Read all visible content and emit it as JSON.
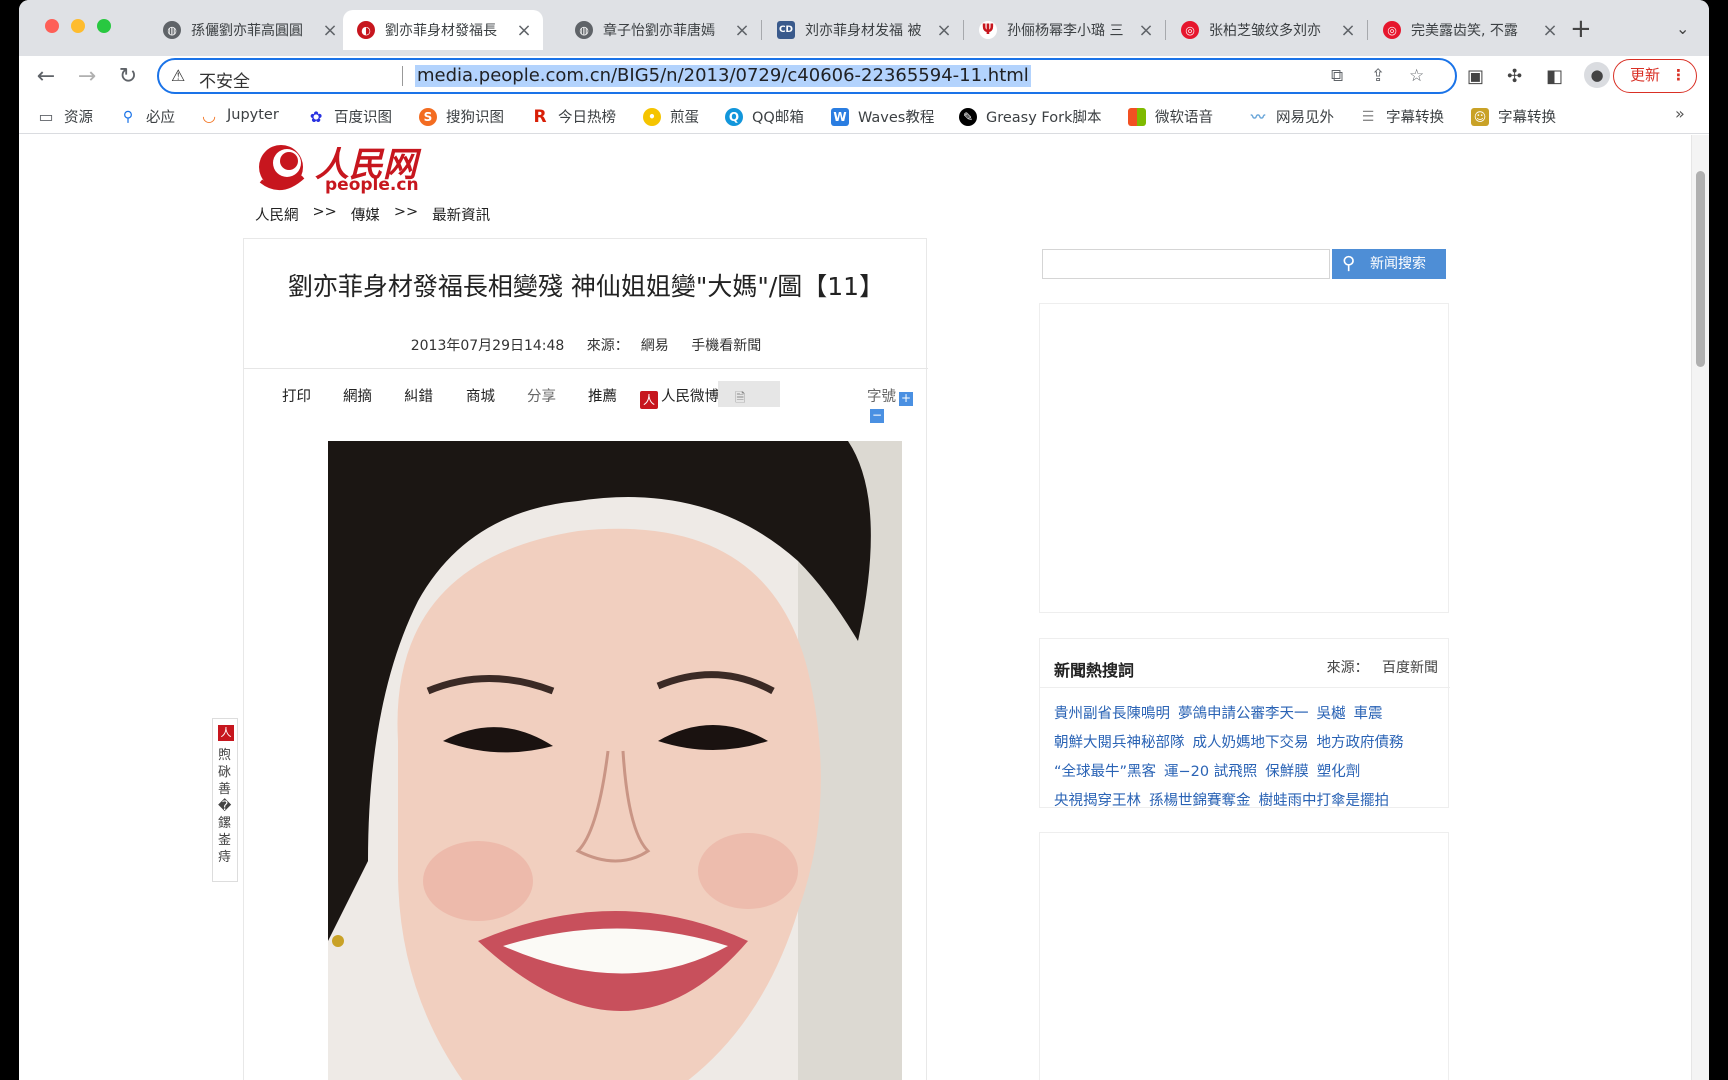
{
  "tabs": [
    {
      "title": "孫儷劉亦菲高圓圓",
      "favicon": "globe-icon",
      "active": false
    },
    {
      "title": "劉亦菲身材發福長",
      "favicon": "people-logo-icon",
      "active": true
    },
    {
      "title": "章子怡劉亦菲唐嫣",
      "favicon": "globe-icon",
      "active": false
    },
    {
      "title": "刘亦菲身材发福 被",
      "favicon": "cd-icon",
      "active": false
    },
    {
      "title": "孙俪杨幂李小璐 三",
      "favicon": "ifeng-icon",
      "active": false
    },
    {
      "title": "张柏芝皱纹多刘亦",
      "favicon": "weibo-icon",
      "active": false
    },
    {
      "title": "完美露齿笑, 不露",
      "favicon": "weibo-icon",
      "active": false
    }
  ],
  "omnibox": {
    "security_label": "不安全",
    "url": "media.people.com.cn/BIG5/n/2013/0729/c40606-22365594-11.html"
  },
  "update_button": "更新",
  "bookmarks": [
    {
      "label": "资源",
      "icon": "folder-icon",
      "color": "#5f6368"
    },
    {
      "label": "必应",
      "icon": "bing-search-icon",
      "color": "#1a73e8"
    },
    {
      "label": "Jupyter",
      "icon": "jupyter-icon",
      "color": "#f37726"
    },
    {
      "label": "百度识图",
      "icon": "baidu-paw-icon",
      "color": "#2932e1"
    },
    {
      "label": "搜狗识图",
      "icon": "sogou-icon",
      "color": "#f36c21"
    },
    {
      "label": "今日热榜",
      "icon": "r-icon",
      "color": "#d81e06"
    },
    {
      "label": "煎蛋",
      "icon": "jandan-chick-icon",
      "color": "#f5c400"
    },
    {
      "label": "QQ邮箱",
      "icon": "qqmail-icon",
      "color": "#1296db"
    },
    {
      "label": "Waves教程",
      "icon": "waves-icon",
      "color": "#2a7de1"
    },
    {
      "label": "Greasy Fork脚本",
      "icon": "greasyfork-icon",
      "color": "#000000"
    },
    {
      "label": "微软语音",
      "icon": "microsoft-icon",
      "color": "#f25022"
    },
    {
      "label": "网易见外",
      "icon": "netease-wave-icon",
      "color": "#6aa6d9"
    },
    {
      "label": "字幕转换",
      "icon": "doc-icon",
      "color": "#888888"
    },
    {
      "label": "字幕转换",
      "icon": "subtitle-face-icon",
      "color": "#c9a227"
    }
  ],
  "logo": {
    "cn": "人民网",
    "en": "people.cn"
  },
  "breadcrumb": {
    "home": "人民網",
    "sep": ">>",
    "section": "傳媒",
    "current": "最新資訊"
  },
  "article": {
    "title": "劉亦菲身材發福長相變殘 神仙姐姐變\"大媽\"/圖【11】",
    "datetime": "2013年07月29日14:48",
    "source_label": "來源：",
    "source": "網易",
    "mobile_link": "手機看新聞"
  },
  "tools": {
    "print": "打印",
    "excerpt": "網摘",
    "correct": "糾錯",
    "mall": "商城",
    "share": "分享",
    "recommend": "推薦",
    "weibo": "人民微博",
    "font_size": "字號",
    "plus": "+",
    "minus": "−"
  },
  "side_tab": {
    "text": "煦砯善�鏍崟痔"
  },
  "search": {
    "button": "新闻搜索"
  },
  "hot": {
    "title": "新聞熱搜詞",
    "source_label": "來源：",
    "source": "百度新聞",
    "lines": [
      [
        "貴州副省長陳鳴明",
        "夢鴿申請公審李天一",
        "吳樾",
        "車震"
      ],
      [
        "朝鮮大閱兵神秘部隊",
        "成人奶媽地下交易",
        "地方政府債務"
      ],
      [
        "“全球最牛”黑客",
        "運−20 試飛照",
        "保鮮膜",
        "塑化劑"
      ],
      [
        "央視揭穿王林",
        "孫楊世錦賽奪金",
        "樹蛙雨中打傘是擺拍"
      ]
    ]
  },
  "colors": {
    "accent": "#1a73e8",
    "brand_red": "#c7161e",
    "link": "#2a63b5",
    "search_btn": "#4e8ed6"
  }
}
